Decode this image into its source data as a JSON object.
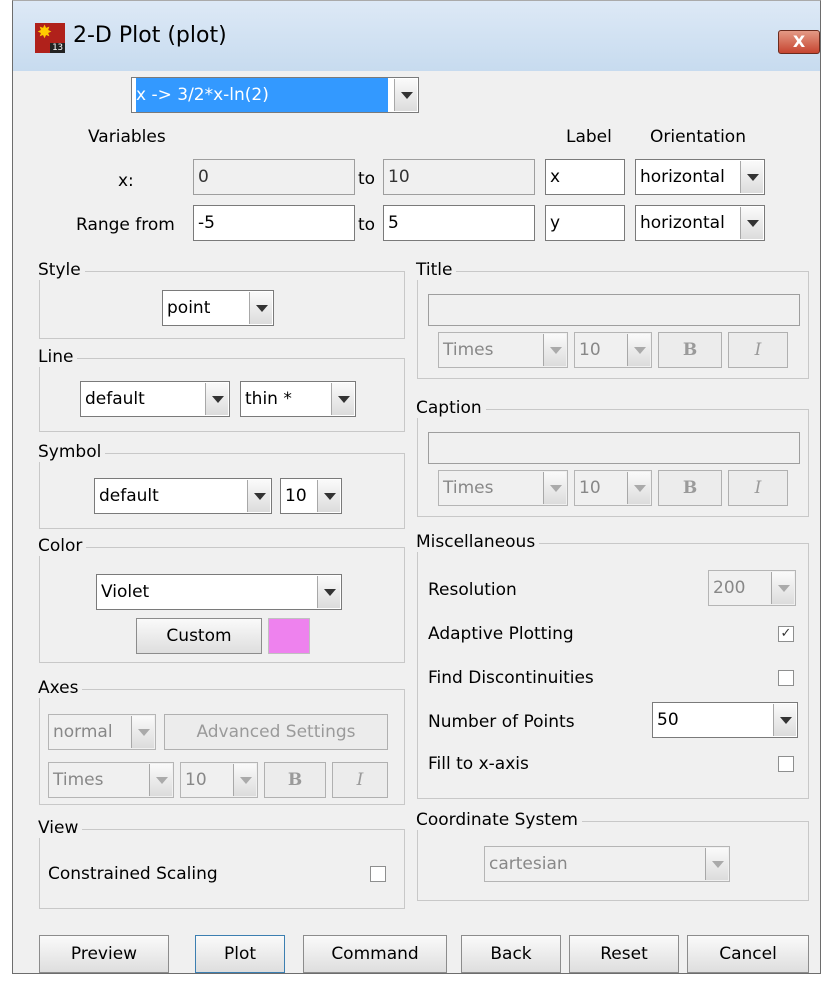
{
  "window": {
    "title": "2-D Plot (plot)",
    "close": "X",
    "icon_label": "13"
  },
  "expression": {
    "value": "x -> 3/2*x-ln(2)"
  },
  "variables": {
    "header": "Variables",
    "label_header": "Label",
    "orientation_header": "Orientation",
    "x_label": "x:",
    "x_from": "0",
    "to1": "to",
    "x_to": "10",
    "x_axis_label": "x",
    "x_orientation": "horizontal",
    "range_label": "Range from",
    "range_from": "-5",
    "to2": "to",
    "range_to": "5",
    "y_axis_label": "y",
    "y_orientation": "horizontal"
  },
  "style": {
    "legend": "Style",
    "value": "point"
  },
  "line": {
    "legend": "Line",
    "style": "default",
    "thickness": "thin *"
  },
  "symbol": {
    "legend": "Symbol",
    "value": "default",
    "size": "10"
  },
  "color": {
    "legend": "Color",
    "value": "Violet",
    "custom_button": "Custom",
    "swatch": "#ee82ee"
  },
  "axes": {
    "legend": "Axes",
    "mode": "normal",
    "advanced_button": "Advanced Settings",
    "font": "Times",
    "size": "10",
    "bold": "B",
    "italic": "I"
  },
  "view": {
    "legend": "View",
    "constrained_label": "Constrained Scaling",
    "constrained": false
  },
  "title_group": {
    "legend": "Title",
    "text": "",
    "font": "Times",
    "size": "10",
    "bold": "B",
    "italic": "I"
  },
  "caption_group": {
    "legend": "Caption",
    "text": "",
    "font": "Times",
    "size": "10",
    "bold": "B",
    "italic": "I"
  },
  "misc": {
    "legend": "Miscellaneous",
    "resolution_label": "Resolution",
    "resolution": "200",
    "adaptive_label": "Adaptive Plotting",
    "adaptive": true,
    "check_mark": "✓",
    "discont_label": "Find Discontinuities",
    "discont": false,
    "points_label": "Number of Points",
    "points": "50",
    "fill_label": "Fill to x-axis",
    "fill": false
  },
  "coord": {
    "legend": "Coordinate System",
    "value": "cartesian"
  },
  "buttons": {
    "preview": "Preview",
    "plot": "Plot",
    "command": "Command",
    "back": "Back",
    "reset": "Reset",
    "cancel": "Cancel"
  }
}
